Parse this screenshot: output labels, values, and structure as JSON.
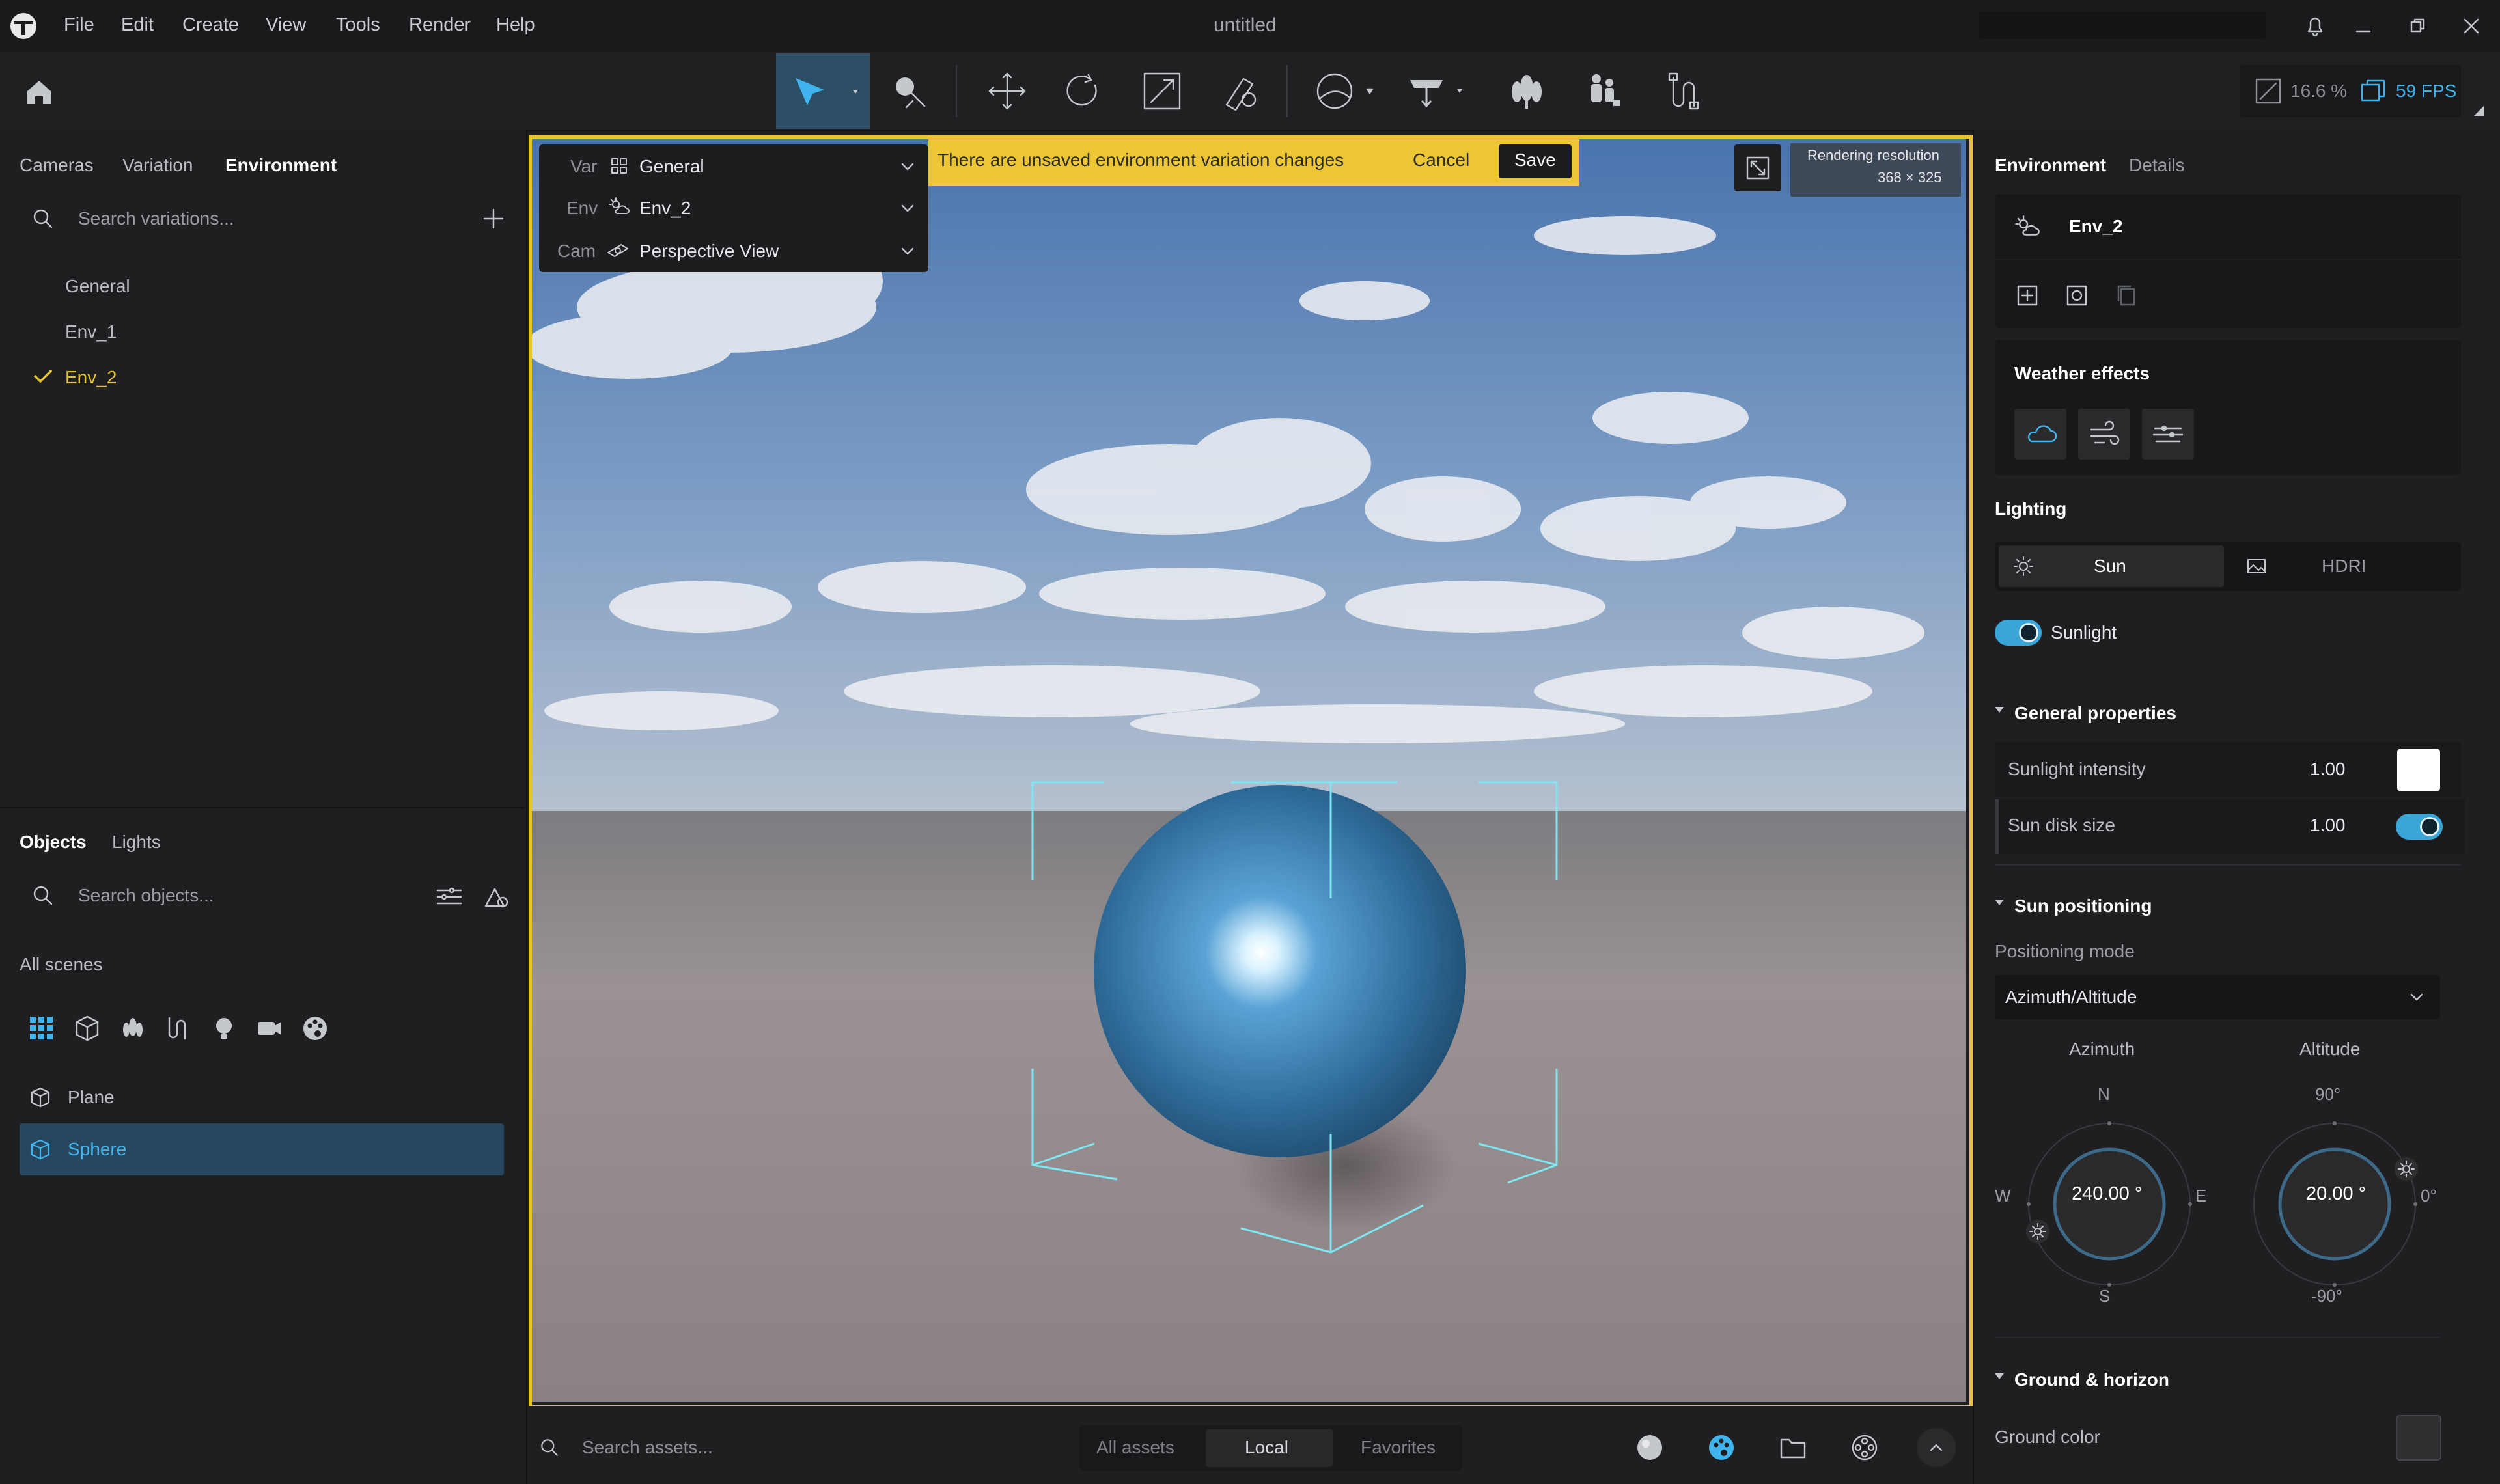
{
  "app": {
    "title": "untitled",
    "menu": [
      "File",
      "Edit",
      "Create",
      "View",
      "Tools",
      "Render",
      "Help"
    ]
  },
  "toolbar": {
    "zoom": "16.6 %",
    "fps": "59 FPS",
    "tools": [
      "select-tool",
      "paint-tool",
      "move-tool",
      "rotate-tool",
      "scale-tool",
      "measure-tool",
      "material-tool",
      "light-tool",
      "trees-tool",
      "people-tool",
      "path-tool"
    ]
  },
  "left": {
    "tabs": [
      "Cameras",
      "Variation",
      "Environment"
    ],
    "active_tab": "Environment",
    "search_placeholder": "Search variations...",
    "variations": [
      "General",
      "Env_1",
      "Env_2"
    ],
    "selected_variation": "Env_2",
    "obj_tabs": [
      "Objects",
      "Lights"
    ],
    "obj_search_placeholder": "Search objects...",
    "all_scenes": "All scenes",
    "objects": [
      "Plane",
      "Sphere"
    ],
    "selected_object": "Sphere"
  },
  "viewport": {
    "var_label": "Var",
    "var_value": "General",
    "env_label": "Env",
    "env_value": "Env_2",
    "cam_label": "Cam",
    "cam_value": "Perspective View",
    "banner": "There are unsaved environment variation changes",
    "cancel": "Cancel",
    "save": "Save",
    "render_res_label": "Rendering resolution",
    "render_res_value": "368 × 325",
    "frame_color": "#e9c32e"
  },
  "bottom": {
    "search_placeholder": "Search assets...",
    "tabs": [
      "All assets",
      "Local",
      "Favorites"
    ],
    "active_tab": "Local"
  },
  "right": {
    "tabs": [
      "Environment",
      "Details"
    ],
    "active_tab": "Environment",
    "env_name": "Env_2",
    "weather_title": "Weather effects",
    "lighting_title": "Lighting",
    "lighting_modes": [
      "Sun",
      "HDRI"
    ],
    "active_mode": "Sun",
    "sunlight_label": "Sunlight",
    "general_props": "General properties",
    "sunlight_intensity_label": "Sunlight intensity",
    "sunlight_intensity": "1.00",
    "sun_disk_label": "Sun disk size",
    "sun_disk": "1.00",
    "sun_positioning": "Sun positioning",
    "positioning_mode_label": "Positioning mode",
    "positioning_mode": "Azimuth/Altitude",
    "azimuth_label": "Azimuth",
    "altitude_label": "Altitude",
    "azimuth_value": "240.00 °",
    "altitude_value": "20.00 °",
    "compass": {
      "n": "N",
      "s": "S",
      "e": "E",
      "w": "W"
    },
    "alt_marks": {
      "top": "90°",
      "bottom": "-90°",
      "right": "0°"
    },
    "ground_horizon": "Ground & horizon",
    "ground_color_label": "Ground color"
  },
  "colors": {
    "accent_blue": "#3aa6d8",
    "accent_yellow": "#e2c22b",
    "selection_bg": "#27475e"
  }
}
